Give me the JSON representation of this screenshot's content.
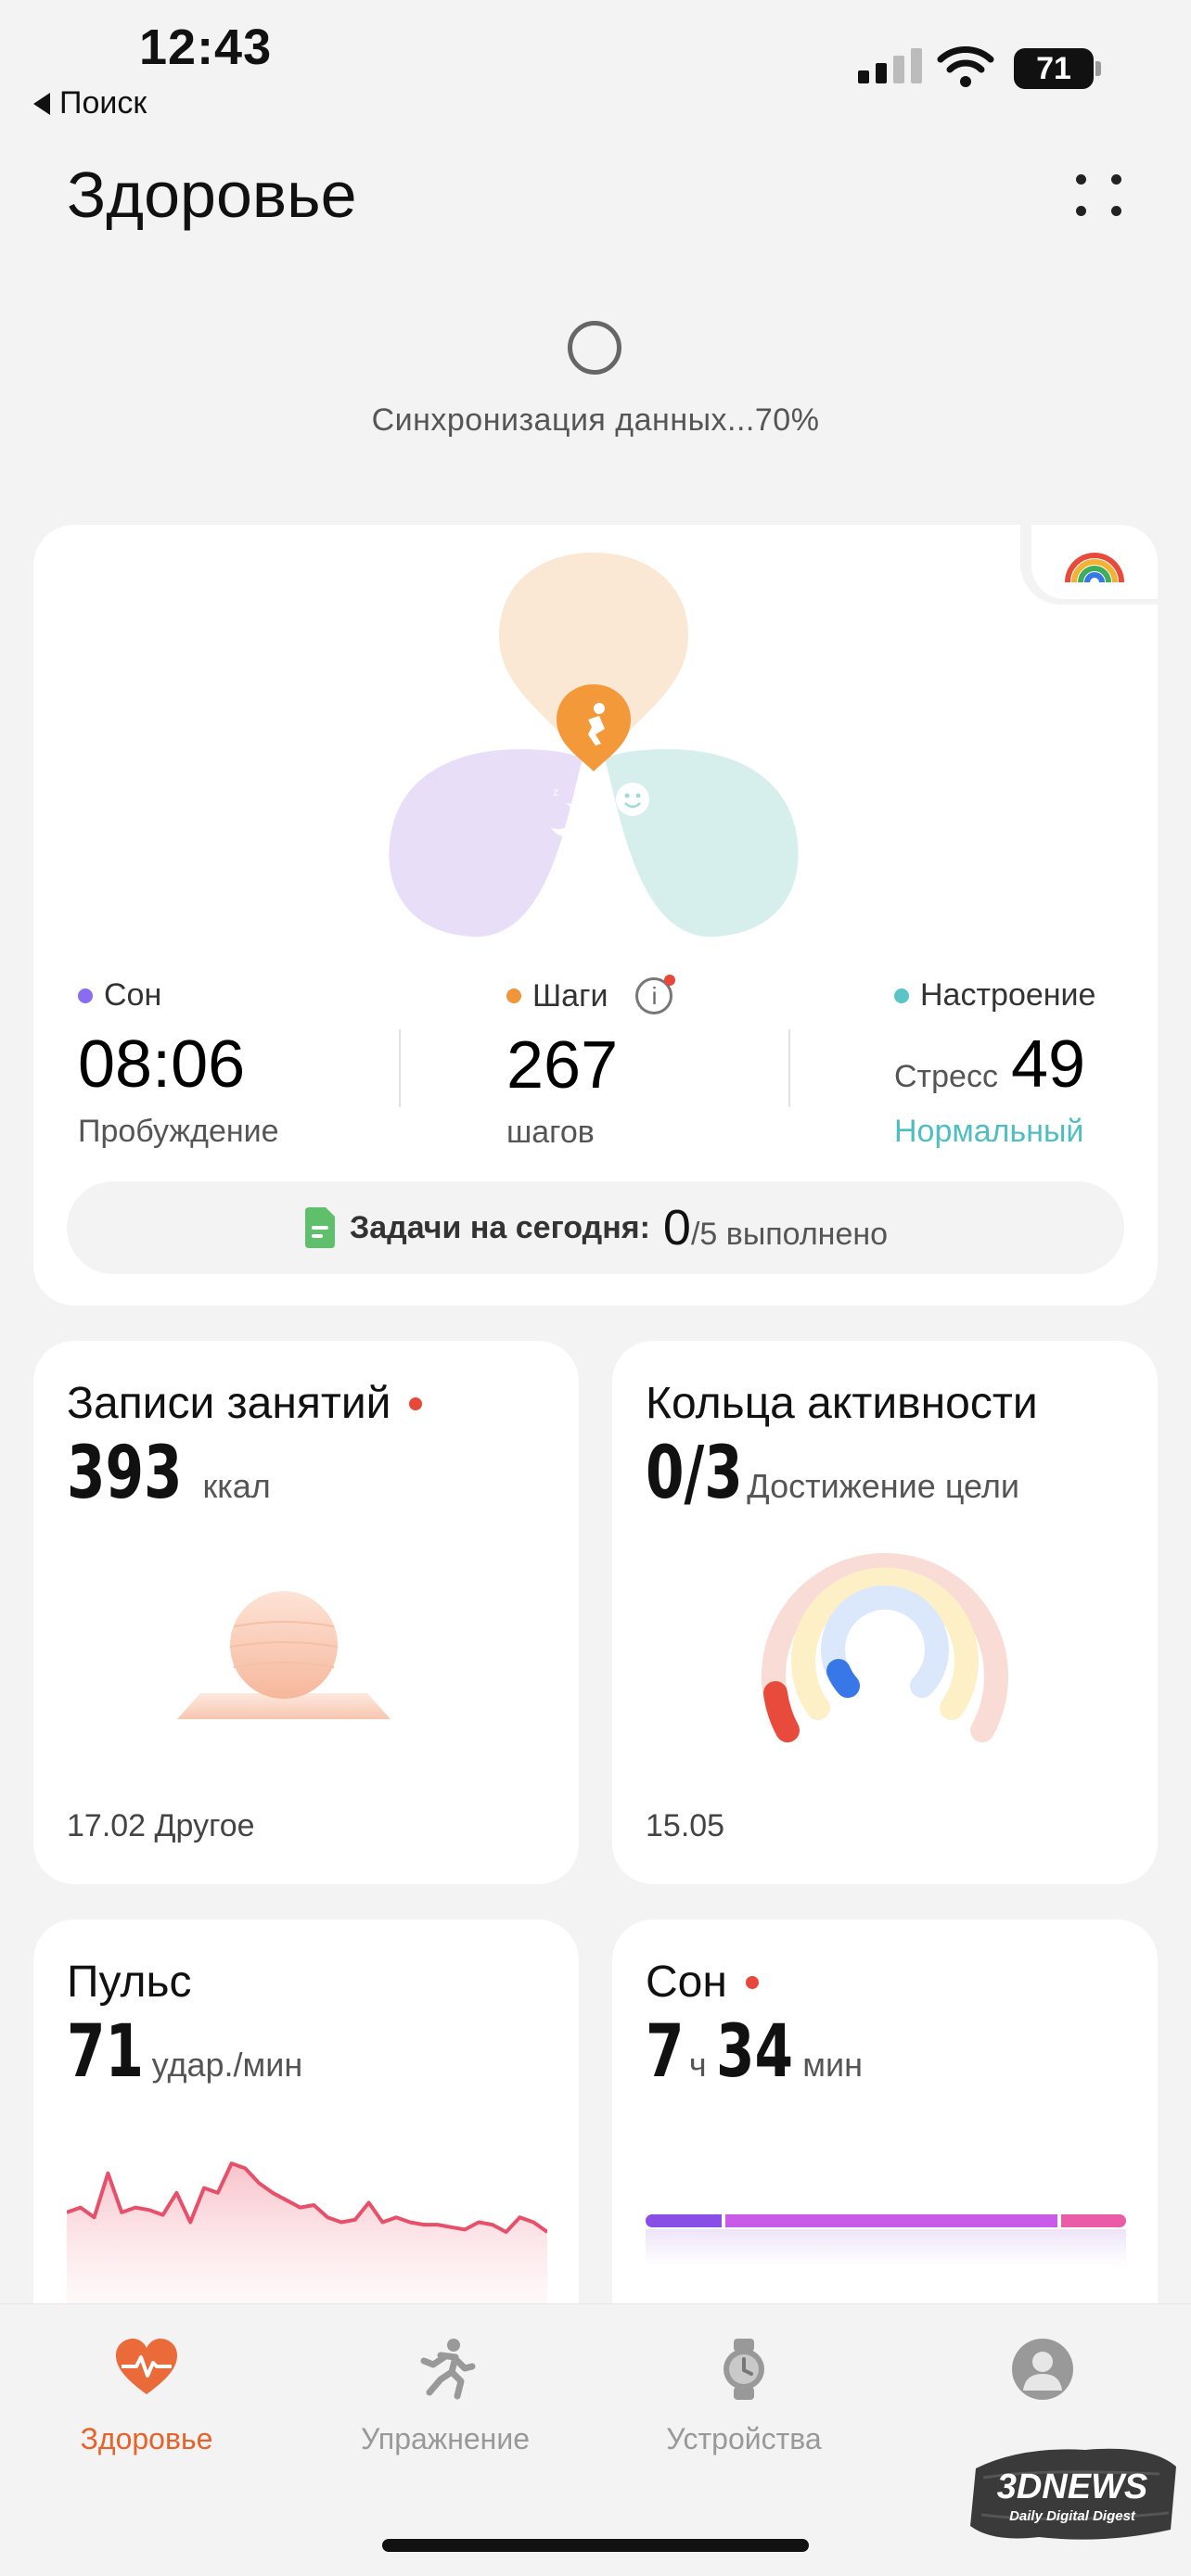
{
  "status_bar": {
    "time": "12:43",
    "back_label": "Поиск",
    "battery": "71"
  },
  "header": {
    "title": "Здоровье",
    "more_icon": "more-dots-icon"
  },
  "sync": {
    "text": "Синхронизация данных...70%"
  },
  "overview": {
    "petal_colors": {
      "top": "#fbe8d4",
      "left": "#e8def8",
      "right": "#d6efec",
      "center": "#f3993a"
    },
    "metrics": [
      {
        "label": "Сон",
        "dot_color": "#8a6cf0",
        "value": "08:06",
        "sub": "Пробуждение"
      },
      {
        "label": "Шаги",
        "dot_color": "#f0953c",
        "value": "267",
        "sub": "шагов"
      },
      {
        "label": "Настроение",
        "dot_color": "#5bc4c6",
        "value_prefix": "Стресс",
        "value": "49",
        "sub": "Нормальный",
        "sub_color": "#4fbec0"
      }
    ],
    "tasks": {
      "label": "Задачи на сегодня:",
      "done": "0",
      "total": "/5 выполнено"
    }
  },
  "cards": {
    "workouts": {
      "title": "Записи занятий",
      "value": "393",
      "unit": "ккал",
      "footer": "17.02 Другое"
    },
    "activity_rings": {
      "title": "Кольца активности",
      "value": "0/3",
      "unit": "Достижение цели",
      "footer": "15.05"
    },
    "heart_rate": {
      "title": "Пульс",
      "value": "71",
      "unit": "удар./мин",
      "series": [
        62,
        64,
        60,
        78,
        62,
        64,
        63,
        61,
        70,
        58,
        72,
        70,
        82,
        80,
        74,
        70,
        67,
        64,
        65,
        60,
        58,
        59,
        66,
        58,
        60,
        58,
        57,
        57,
        56,
        55,
        58,
        57,
        54,
        60,
        58,
        54
      ]
    },
    "sleep": {
      "title": "Сон",
      "hours": "7",
      "hours_unit": "ч",
      "minutes": "34",
      "minutes_unit": "мин"
    }
  },
  "tabbar": {
    "tabs": [
      {
        "label": "Здоровье",
        "icon": "heart-pulse-icon",
        "active": true
      },
      {
        "label": "Упражнение",
        "icon": "running-person-icon",
        "active": false
      },
      {
        "label": "Устройства",
        "icon": "watch-icon",
        "active": false
      },
      {
        "label": "",
        "icon": "profile-avatar-icon",
        "active": false
      }
    ]
  },
  "watermark": {
    "brand": "3DNEWS",
    "tagline": "Daily Digital Digest"
  }
}
